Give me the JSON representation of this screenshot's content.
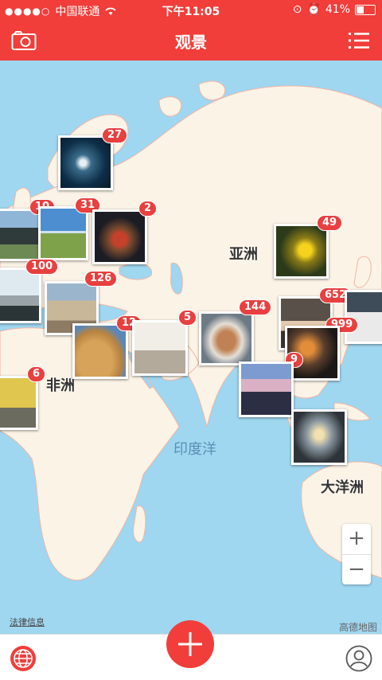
{
  "status_bar": {
    "carrier": "中国联通",
    "time": "下午11:05",
    "battery_text": "41%",
    "battery_level": 0.41
  },
  "nav": {
    "title": "观景"
  },
  "map": {
    "continent_labels": {
      "asia": "亚洲",
      "africa": "非洲",
      "oceania": "大洋洲"
    },
    "ocean_label": "印度洋",
    "legal_text": "法律信息",
    "provider": "高德地图",
    "zoom_in": "+",
    "zoom_out": "−"
  },
  "photo_counts": {
    "ocean_storm": "27",
    "iceland": "10",
    "field": "31",
    "moscow": "2",
    "china_flowers": "49",
    "harbor": "100",
    "rome": "126",
    "egypt": "12",
    "mosque": "5",
    "india_food": "144",
    "shanghai_girl": "652",
    "japan": "999",
    "hongkong": "9",
    "west_africa": "6"
  }
}
